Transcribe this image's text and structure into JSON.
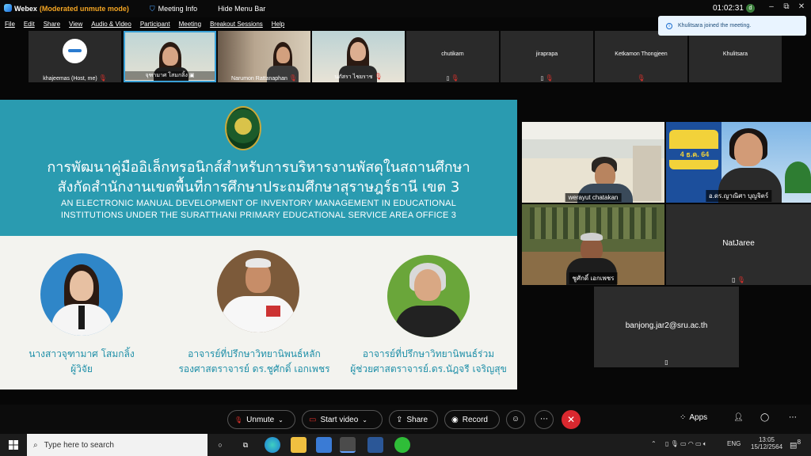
{
  "titlebar": {
    "app_name": "Webex",
    "mode": "(Moderated unmute mode)",
    "meeting_info": "Meeting Info",
    "hide_menu": "Hide Menu Bar",
    "elapsed": "01:02:31",
    "controls": [
      "–",
      "▢",
      "✕",
      "⧉"
    ]
  },
  "menu": [
    "File",
    "Edit",
    "Share",
    "View",
    "Audio & Video",
    "Participant",
    "Meeting",
    "Breakout Sessions",
    "Help"
  ],
  "toast": {
    "text": "Khulitsara joined the meeting."
  },
  "top_tiles": [
    {
      "name": "khajeemas  (Host, me)",
      "video": false,
      "avatar": true
    },
    {
      "name": "จุฑามาศ โสมกลิ้ง",
      "video": true
    },
    {
      "name": "Narumon Rattanaphan",
      "video": true
    },
    {
      "name": "นภัสรา ไชยราช",
      "video": true
    },
    {
      "name": "chutikarn",
      "video": false
    },
    {
      "name": "jiraprapa",
      "video": false
    },
    {
      "name": "Ketkamon Thongjeen",
      "video": false
    },
    {
      "name": "Khulitsara",
      "video": false
    }
  ],
  "slide": {
    "title_th_1": "การพัฒนาคู่มืออิเล็กทรอนิกส์สำหรับการบริหารงานพัสดุในสถานศึกษา",
    "title_th_2": "สังกัดสำนักงานเขตพื้นที่การศึกษาประถมศึกษาสุราษฎร์ธานี เขต 3",
    "title_en_1": "AN ELECTRONIC MANUAL DEVELOPMENT OF INVENTORY MANAGEMENT IN EDUCATIONAL",
    "title_en_2": "INSTITUTIONS UNDER THE SURATTHANI PRIMARY EDUCATIONAL SERVICE AREA OFFICE 3",
    "people": [
      {
        "line1": "นางสาวจุฑามาศ โสมกลิ้ง",
        "line2": "ผู้วิจัย"
      },
      {
        "line1": "อาจารย์ที่ปรึกษาวิทยานิพนธ์หลัก",
        "line2": "รองศาสตราจารย์ ดร.ชูศักดิ์ เอกเพชร"
      },
      {
        "line1": "อาจารย์ที่ปรึกษาวิทยานิพนธ์ร่วม",
        "line2": "ผู้ช่วยศาสตราจารย์.ดร.นัฎจรี เจริญสุข"
      }
    ]
  },
  "right_tiles": {
    "werayut": "werayut chatakan",
    "yanisa": "อ.ดร.ญาณิศา บุญจิตร์",
    "poster_date": "4 ธ.ค. 64",
    "chusak": "ชูศักดิ์ เอกเพชร",
    "natjaree": "NatJaree",
    "banjong": "banjong.jar2@sru.ac.th"
  },
  "controls": {
    "unmute": "Unmute",
    "start_video": "Start video",
    "share": "Share",
    "record": "Record",
    "apps": "Apps"
  },
  "taskbar": {
    "search_placeholder": "Type here to search",
    "lang": "ENG",
    "time": "13:05",
    "date": "15/12/2564",
    "notif_count": "8"
  }
}
